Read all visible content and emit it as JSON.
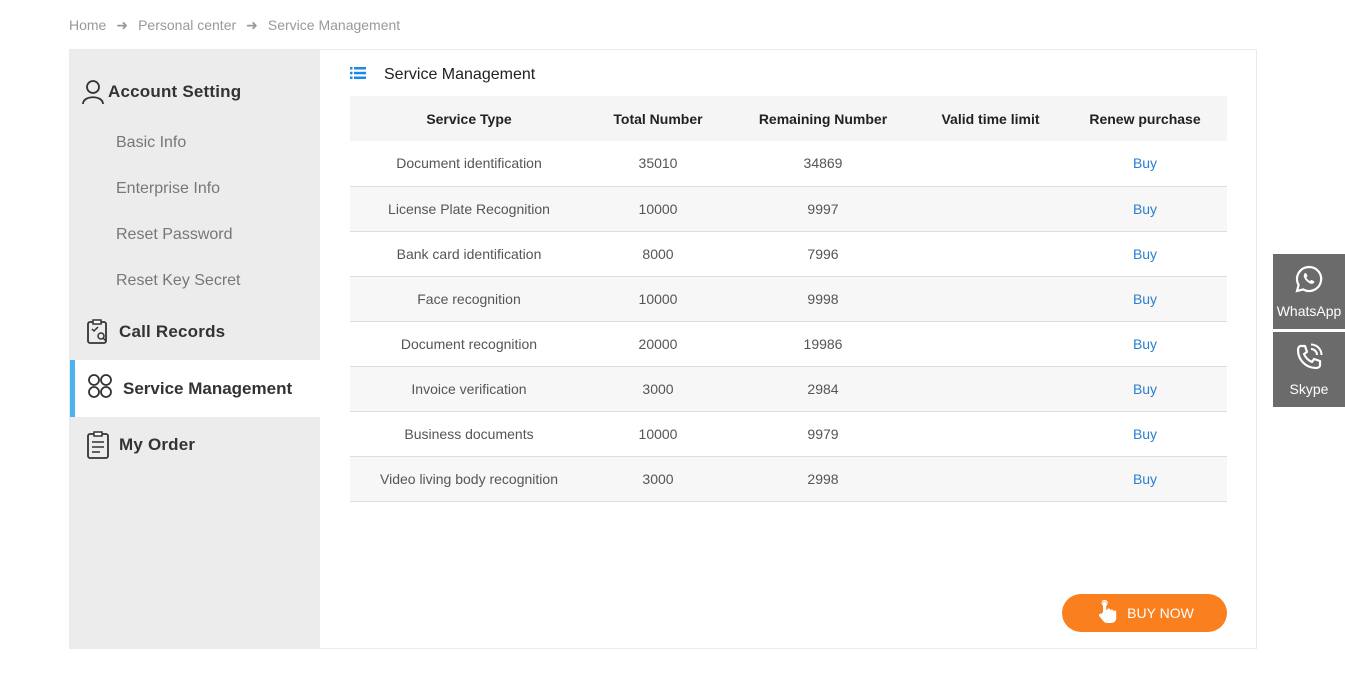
{
  "breadcrumb": {
    "items": [
      "Home",
      "Personal center",
      "Service Management"
    ],
    "separator": "➜"
  },
  "sidebar": {
    "account_setting": "Account Setting",
    "sub_items": [
      "Basic Info",
      "Enterprise Info",
      "Reset Password",
      "Reset Key Secret"
    ],
    "call_records": "Call Records",
    "service_management": "Service Management",
    "my_order": "My Order",
    "active_color": "#4cb3f0"
  },
  "main": {
    "title": "Service Management",
    "headers": [
      "Service Type",
      "Total Number",
      "Remaining Number",
      "Valid time limit",
      "Renew purchase"
    ],
    "rows": [
      {
        "type": "Document identification",
        "total": "35010",
        "remaining": "34869",
        "valid": "",
        "action": "Buy"
      },
      {
        "type": "License Plate Recognition",
        "total": "10000",
        "remaining": "9997",
        "valid": "",
        "action": "Buy"
      },
      {
        "type": "Bank card identification",
        "total": "8000",
        "remaining": "7996",
        "valid": "",
        "action": "Buy"
      },
      {
        "type": "Face recognition",
        "total": "10000",
        "remaining": "9998",
        "valid": "",
        "action": "Buy"
      },
      {
        "type": "Document recognition",
        "total": "20000",
        "remaining": "19986",
        "valid": "",
        "action": "Buy"
      },
      {
        "type": "Invoice verification",
        "total": "3000",
        "remaining": "2984",
        "valid": "",
        "action": "Buy"
      },
      {
        "type": "Business documents",
        "total": "10000",
        "remaining": "9979",
        "valid": "",
        "action": "Buy"
      },
      {
        "type": "Video living body recognition",
        "total": "3000",
        "remaining": "2998",
        "valid": "",
        "action": "Buy"
      }
    ],
    "buy_now": "BUY NOW",
    "buy_now_color": "#f97f1f",
    "link_color": "#2a7fd0"
  },
  "floating": {
    "whatsapp": "WhatsApp",
    "skype": "Skype"
  }
}
